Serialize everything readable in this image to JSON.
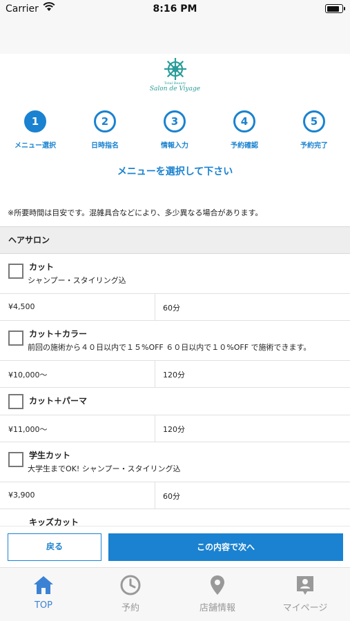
{
  "status_bar": {
    "carrier": "Carrier",
    "time": "8:16 PM",
    "battery_level": 0.85
  },
  "logo": {
    "tagline": "Total Beauty",
    "name": "Salon de Viyage"
  },
  "steps": [
    {
      "number": "1",
      "label": "メニュー選択"
    },
    {
      "number": "2",
      "label": "日時指名"
    },
    {
      "number": "3",
      "label": "情報入力"
    },
    {
      "number": "4",
      "label": "予約確認"
    },
    {
      "number": "5",
      "label": "予約完了"
    }
  ],
  "active_step": 1,
  "instruction": "メニューを選択して下さい",
  "note": "※所要時間は目安です。混雑具合などにより、多少異なる場合があります。",
  "section": {
    "title": "ヘアサロン"
  },
  "menu_items": [
    {
      "name": "カット",
      "desc": "シャンプー・スタイリング込",
      "price": "¥4,500",
      "duration": "60分"
    },
    {
      "name": "カット＋カラー",
      "desc": "前回の施術から４０日以内で１５%OFF ６０日以内で１０%OFF で施術できます。",
      "price": "¥10,000〜",
      "duration": "120分"
    },
    {
      "name": "カット＋パーマ",
      "desc": "",
      "price": "¥11,000〜",
      "duration": "120分"
    },
    {
      "name": "学生カット",
      "desc": "大学生までOK! シャンプー・スタイリング込",
      "price": "¥3,900",
      "duration": "60分"
    },
    {
      "name": "キッズカット",
      "desc": "",
      "price": "",
      "duration": ""
    }
  ],
  "actions": {
    "back": "戻る",
    "next": "この内容で次へ"
  },
  "tabs": [
    {
      "label": "TOP",
      "icon": "home-icon"
    },
    {
      "label": "予約",
      "icon": "clock-icon"
    },
    {
      "label": "店舗情報",
      "icon": "map-pin-icon"
    },
    {
      "label": "マイページ",
      "icon": "profile-badge-icon"
    }
  ],
  "colors": {
    "accent": "#1a82d0",
    "logo": "#2a9d99",
    "tab_active": "#3b82d4",
    "tab_inactive": "#999999"
  }
}
